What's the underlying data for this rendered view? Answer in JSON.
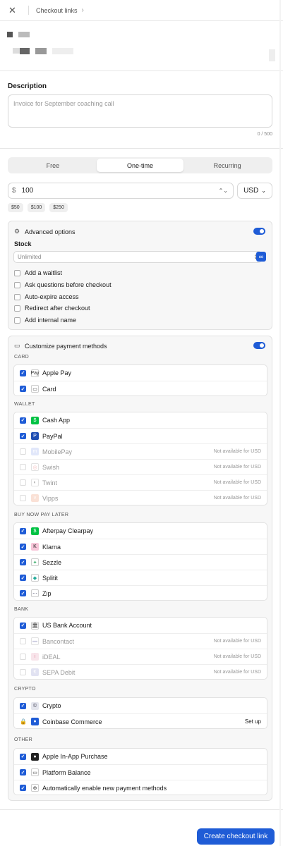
{
  "header": {
    "breadcrumb": "Checkout links",
    "close_icon": "close-icon",
    "chevron_icon": "chevron-right-icon"
  },
  "description": {
    "label": "Description",
    "placeholder": "Invoice for September coaching call",
    "counter": "0 / 500"
  },
  "pricing_tabs": [
    "Free",
    "One-time",
    "Recurring"
  ],
  "active_tab": "One-time",
  "price": {
    "currency_symbol": "$",
    "value": "100",
    "currency": "USD",
    "presets": [
      "$50",
      "$100",
      "$250"
    ]
  },
  "advanced": {
    "title": "Advanced options",
    "enabled": true,
    "stock_label": "Stock",
    "stock_placeholder": "Unlimited",
    "options": [
      "Add a waitlist",
      "Ask questions before checkout",
      "Auto-expire access",
      "Redirect after checkout",
      "Add internal name"
    ]
  },
  "payments": {
    "title": "Customize payment methods",
    "enabled": true,
    "na_text": "Not available for USD",
    "groups": [
      {
        "name": "CARD",
        "items": [
          {
            "label": "Apple Pay",
            "checked": true,
            "icon": "apple-pay-icon"
          },
          {
            "label": "Card",
            "checked": true,
            "icon": "card-icon"
          }
        ]
      },
      {
        "name": "WALLET",
        "items": [
          {
            "label": "Cash App",
            "checked": true,
            "icon": "cash-app-icon"
          },
          {
            "label": "PayPal",
            "checked": true,
            "icon": "paypal-icon"
          },
          {
            "label": "MobilePay",
            "checked": false,
            "icon": "mobilepay-icon",
            "note": "Not available for USD"
          },
          {
            "label": "Swish",
            "checked": false,
            "icon": "swish-icon",
            "note": "Not available for USD"
          },
          {
            "label": "Twint",
            "checked": false,
            "icon": "twint-icon",
            "note": "Not available for USD"
          },
          {
            "label": "Vipps",
            "checked": false,
            "icon": "vipps-icon",
            "note": "Not available for USD"
          }
        ]
      },
      {
        "name": "BUY NOW PAY LATER",
        "items": [
          {
            "label": "Afterpay Clearpay",
            "checked": true,
            "icon": "afterpay-icon"
          },
          {
            "label": "Klarna",
            "checked": true,
            "icon": "klarna-icon"
          },
          {
            "label": "Sezzle",
            "checked": true,
            "icon": "sezzle-icon"
          },
          {
            "label": "Splitit",
            "checked": true,
            "icon": "splitit-icon"
          },
          {
            "label": "Zip",
            "checked": true,
            "icon": "zip-icon"
          }
        ]
      },
      {
        "name": "BANK",
        "items": [
          {
            "label": "US Bank Account",
            "checked": true,
            "icon": "bank-icon"
          },
          {
            "label": "Bancontact",
            "checked": false,
            "icon": "bancontact-icon",
            "note": "Not available for USD"
          },
          {
            "label": "iDEAL",
            "checked": false,
            "icon": "ideal-icon",
            "note": "Not available for USD"
          },
          {
            "label": "SEPA Debit",
            "checked": false,
            "icon": "sepa-icon",
            "note": "Not available for USD"
          }
        ]
      },
      {
        "name": "CRYPTO",
        "items": [
          {
            "label": "Crypto",
            "checked": true,
            "icon": "crypto-icon"
          },
          {
            "label": "Coinbase Commerce",
            "checked": false,
            "icon": "coinbase-icon",
            "locked": true,
            "action": "Set up"
          }
        ]
      },
      {
        "name": "OTHER",
        "items": [
          {
            "label": "Apple In-App Purchase",
            "checked": true,
            "icon": "apple-iap-icon"
          },
          {
            "label": "Platform Balance",
            "checked": true,
            "icon": "wallet-icon"
          },
          {
            "label": "Automatically enable new payment methods",
            "checked": true,
            "icon": "globe-icon"
          }
        ]
      }
    ]
  },
  "footer": {
    "create_label": "Create checkout link"
  },
  "colors": {
    "accent": "#1f5cd6"
  }
}
